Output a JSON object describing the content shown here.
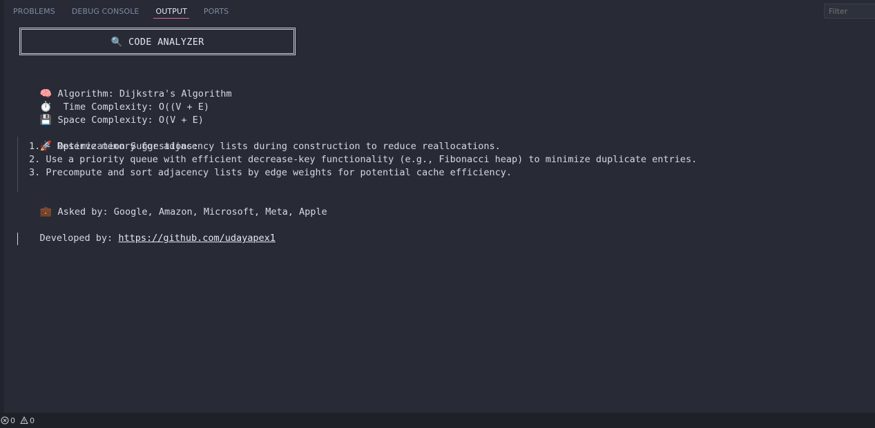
{
  "tabs": [
    {
      "label": "PROBLEMS"
    },
    {
      "label": "DEBUG CONSOLE"
    },
    {
      "label": "OUTPUT"
    },
    {
      "label": "PORTS"
    }
  ],
  "active_tab": "OUTPUT",
  "filter": {
    "placeholder": "Filter"
  },
  "output": {
    "banner_icon": "🔍",
    "banner_title": "CODE ANALYZER",
    "algorithm": {
      "icon": "🧠",
      "text": "Algorithm: Dijkstra's Algorithm"
    },
    "time": {
      "icon": "⏱️",
      "text": " Time Complexity: O((V + E)"
    },
    "space": {
      "icon": "💾",
      "text": "Space Complexity: O(V + E)"
    },
    "suggestions_header": {
      "icon": "🚀",
      "text": "Optimization Suggestions:"
    },
    "suggestions": [
      "1. - Reserve memory for adjacency lists during construction to reduce reallocations.",
      "2. Use a priority queue with efficient decrease-key functionality (e.g., Fibonacci heap) to minimize duplicate entries.",
      "3. Precompute and sort adjacency lists by edge weights for potential cache efficiency."
    ],
    "asked_by": {
      "icon": "💼",
      "text": "Asked by: Google, Amazon, Microsoft, Meta, Apple"
    },
    "developed_label": "Developed by: ",
    "developed_link": "https://github.com/udayapex1"
  },
  "status": {
    "errors": "0",
    "warnings": "0",
    "error_icon": "circle-x-icon",
    "warning_icon": "warning-triangle-icon"
  },
  "colors": {
    "background": "#282b36",
    "active_tab_underline": "#e6669d",
    "inactive_tab": "#7e8aa3",
    "text": "#d6d9e0"
  }
}
